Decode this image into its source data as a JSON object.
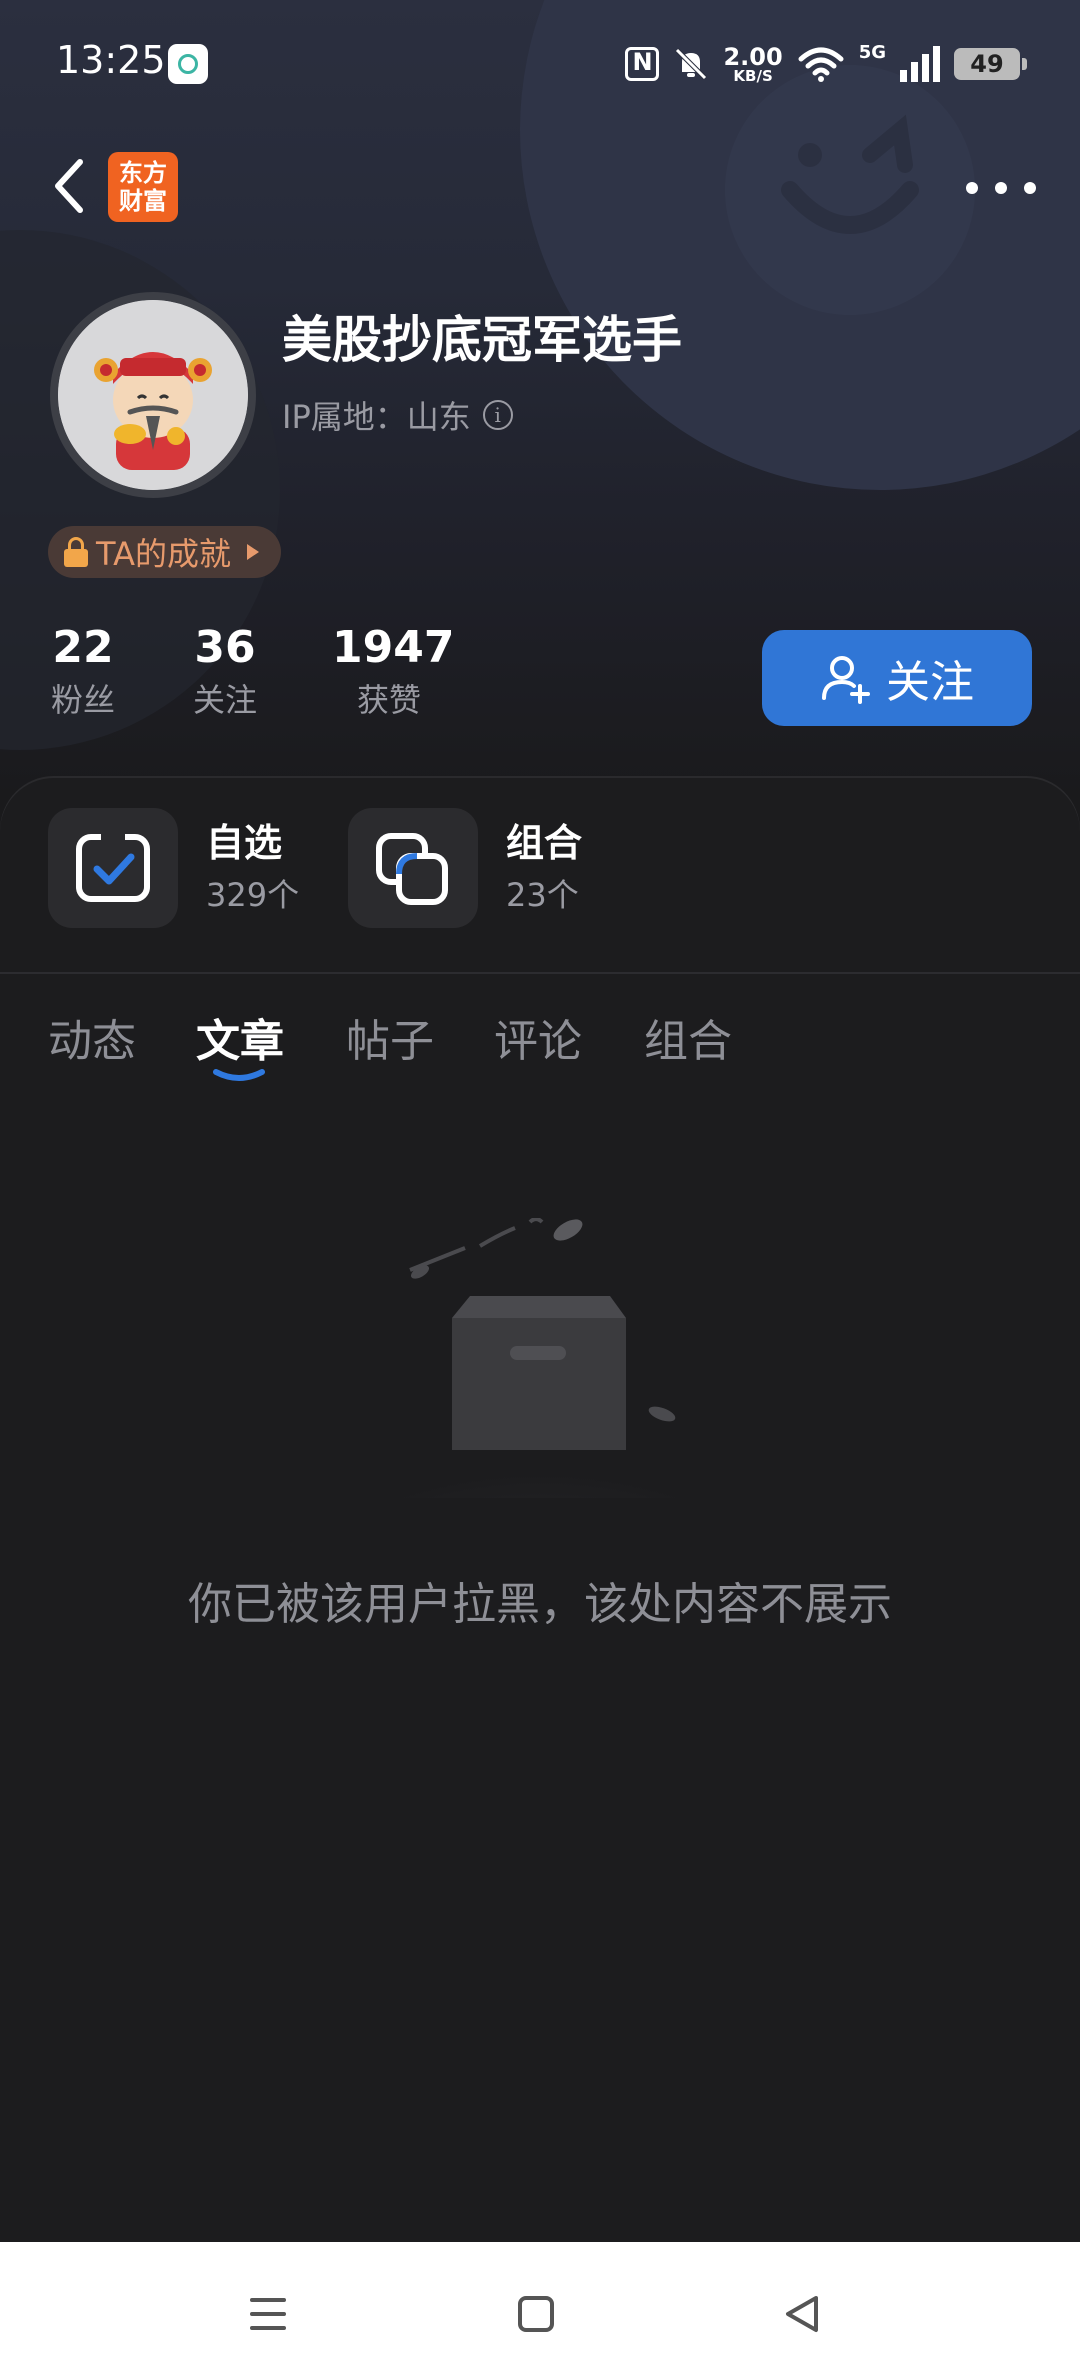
{
  "status_bar": {
    "time": "13:25",
    "net_speed_value": "2.00",
    "net_speed_unit": "KB/S",
    "signal_label": "5G",
    "battery": "49"
  },
  "header": {
    "logo_line1": "东方",
    "logo_line2": "财富",
    "logo_color": "#f06321"
  },
  "profile": {
    "username": "美股抄底冠军选手",
    "ip_location": "IP属地：山东",
    "achievement_label": "TA的成就",
    "stats": [
      {
        "value": "22",
        "label": "粉丝"
      },
      {
        "value": "36",
        "label": "关注"
      },
      {
        "value": "1947",
        "label": "获赞"
      }
    ],
    "follow_label": "关注",
    "follow_color": "#3076d6"
  },
  "quick_links": [
    {
      "title": "自选",
      "count": "329个"
    },
    {
      "title": "组合",
      "count": "23个"
    }
  ],
  "tabs": [
    {
      "label": "动态",
      "active": false
    },
    {
      "label": "文章",
      "active": true
    },
    {
      "label": "帖子",
      "active": false
    },
    {
      "label": "评论",
      "active": false
    },
    {
      "label": "组合",
      "active": false
    }
  ],
  "empty_message": "你已被该用户拉黑，该处内容不展示"
}
